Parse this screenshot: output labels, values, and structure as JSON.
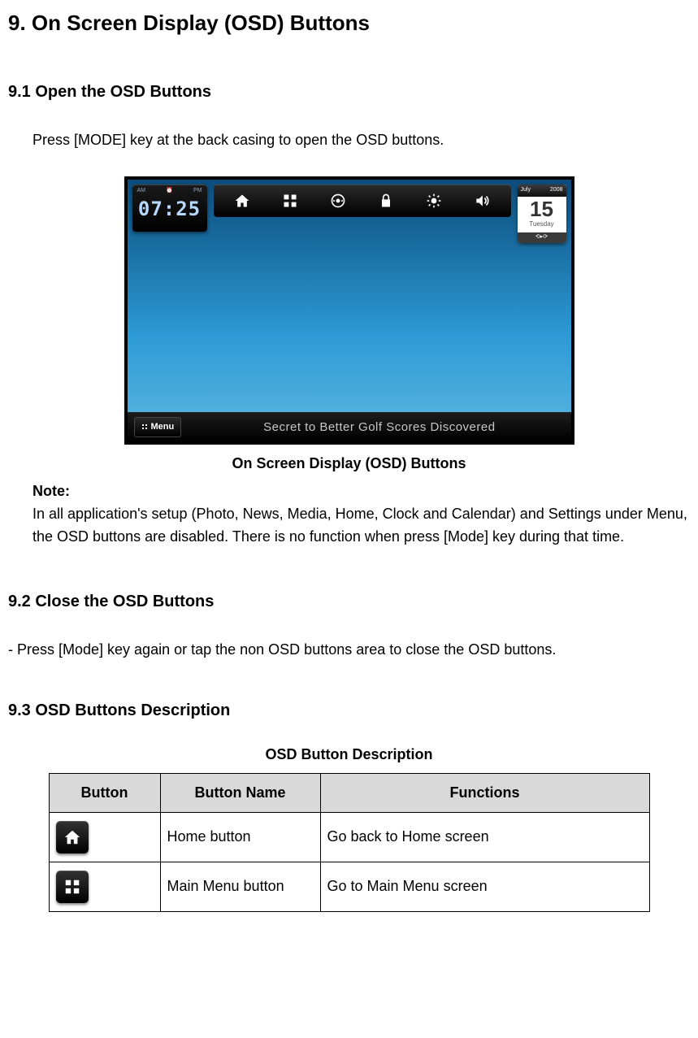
{
  "title": "9. On Screen Display (OSD) Buttons",
  "s91": {
    "heading": "9.1 Open the OSD Buttons",
    "instruction": "Press [MODE] key at the back casing to open the OSD buttons.",
    "caption": "On Screen Display (OSD) Buttons",
    "note_label": "Note:",
    "note_text": "In all application's setup (Photo, News, Media, Home, Clock and Calendar) and Settings under Menu, the OSD buttons are disabled. There is no function when press [Mode] key during that time."
  },
  "screenshot": {
    "clock": {
      "am": "AM",
      "alarm": "⏰",
      "pm": "PM",
      "time": "07:25"
    },
    "osd_icons": [
      "home-icon",
      "grid-icon",
      "media-icon",
      "lock-icon",
      "brightness-icon",
      "volume-icon"
    ],
    "calendar": {
      "month": "July",
      "year": "2008",
      "day": "15",
      "dow": "Tuesday",
      "footer": "⟲▸⟳"
    },
    "menu_label": "Menu",
    "ticker": "Secret to Better Golf Scores Discovered"
  },
  "s92": {
    "heading": "9.2 Close the OSD Buttons",
    "text": "- Press [Mode] key again or tap the non OSD buttons area to close the OSD buttons."
  },
  "s93": {
    "heading": "9.3 OSD Buttons Description",
    "table_title": "OSD Button Description",
    "headers": {
      "button": "Button",
      "name": "Button Name",
      "functions": "Functions"
    },
    "rows": [
      {
        "icon": "home",
        "name": "Home button",
        "func": "Go back to Home screen"
      },
      {
        "icon": "grid",
        "name": "Main Menu button",
        "func": "Go to Main Menu screen"
      }
    ]
  }
}
